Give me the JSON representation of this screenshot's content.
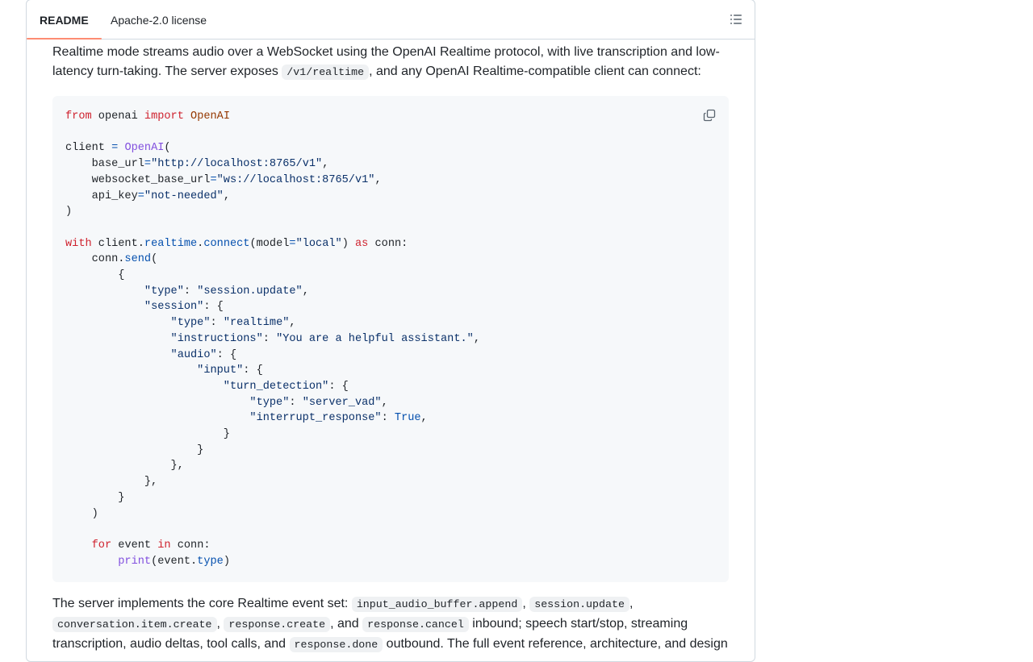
{
  "tabs": {
    "readme": "README",
    "license": "Apache-2.0 license"
  },
  "icons": {
    "outline": "list-unordered-icon",
    "copy": "copy-icon"
  },
  "intro": {
    "text_before": "Realtime mode streams audio over a WebSocket using the OpenAI Realtime protocol, with live transcription and low-latency turn-taking. The server exposes ",
    "code": "/v1/realtime",
    "text_after": ", and any OpenAI Realtime-compatible client can connect:"
  },
  "code": {
    "l1": {
      "kw1": "from",
      "t1": " openai ",
      "kw2": "import",
      "cls": "OpenAI"
    },
    "l3": {
      "t1": "client ",
      "op": "=",
      "cls": "OpenAI",
      "t2": "("
    },
    "l4": {
      "t1": "    base_url",
      "op": "=",
      "st": "\"http://localhost:8765/v1\"",
      "t2": ","
    },
    "l5": {
      "t1": "    websocket_base_url",
      "op": "=",
      "st": "\"ws://localhost:8765/v1\"",
      "t2": ","
    },
    "l6": {
      "t1": "    api_key",
      "op": "=",
      "st": "\"not-needed\"",
      "t2": ","
    },
    "l7": {
      "t1": ")"
    },
    "l9": {
      "kw1": "with",
      "t1": " client.",
      "at1": "realtime",
      "t2": ".",
      "at2": "connect",
      "t3": "(model",
      "op": "=",
      "st": "\"local\"",
      "t4": ") ",
      "kw2": "as",
      "t5": " conn:"
    },
    "l10": {
      "t1": "    conn.",
      "at": "send",
      "t2": "("
    },
    "l11": {
      "t1": "        {"
    },
    "l12": {
      "t1": "            ",
      "st1": "\"type\"",
      "t2": ": ",
      "st2": "\"session.update\"",
      "t3": ","
    },
    "l13": {
      "t1": "            ",
      "st1": "\"session\"",
      "t2": ": {"
    },
    "l14": {
      "t1": "                ",
      "st1": "\"type\"",
      "t2": ": ",
      "st2": "\"realtime\"",
      "t3": ","
    },
    "l15": {
      "t1": "                ",
      "st1": "\"instructions\"",
      "t2": ": ",
      "st2": "\"You are a helpful assistant.\"",
      "t3": ","
    },
    "l16": {
      "t1": "                ",
      "st1": "\"audio\"",
      "t2": ": {"
    },
    "l17": {
      "t1": "                    ",
      "st1": "\"input\"",
      "t2": ": {"
    },
    "l18": {
      "t1": "                        ",
      "st1": "\"turn_detection\"",
      "t2": ": {"
    },
    "l19": {
      "t1": "                            ",
      "st1": "\"type\"",
      "t2": ": ",
      "st2": "\"server_vad\"",
      "t3": ","
    },
    "l20": {
      "t1": "                            ",
      "st1": "\"interrupt_response\"",
      "t2": ": ",
      "kw": "True",
      "t3": ","
    },
    "l21": {
      "t1": "                        }"
    },
    "l22": {
      "t1": "                    }"
    },
    "l23": {
      "t1": "                },"
    },
    "l24": {
      "t1": "            },"
    },
    "l25": {
      "t1": "        }"
    },
    "l26": {
      "t1": "    )"
    },
    "l28": {
      "t1": "    ",
      "kw1": "for",
      "t2": " event ",
      "kw2": "in",
      "t3": " conn:"
    },
    "l29": {
      "t1": "        ",
      "bi": "print",
      "t2": "(event.",
      "at": "type",
      "t3": ")"
    }
  },
  "events": {
    "t1": "The server implements the core Realtime event set: ",
    "c1": "input_audio_buffer.append",
    "t2": ", ",
    "c2": "session.update",
    "t3": ", ",
    "c3": "conversation.item.create",
    "t4": ", ",
    "c4": "response.create",
    "t5": ", and ",
    "c5": "response.cancel",
    "t6": " inbound; speech start/stop, streaming transcription, audio deltas, tool calls, and ",
    "c6": "response.done",
    "t7": " outbound. The full event reference, architecture, and design"
  }
}
